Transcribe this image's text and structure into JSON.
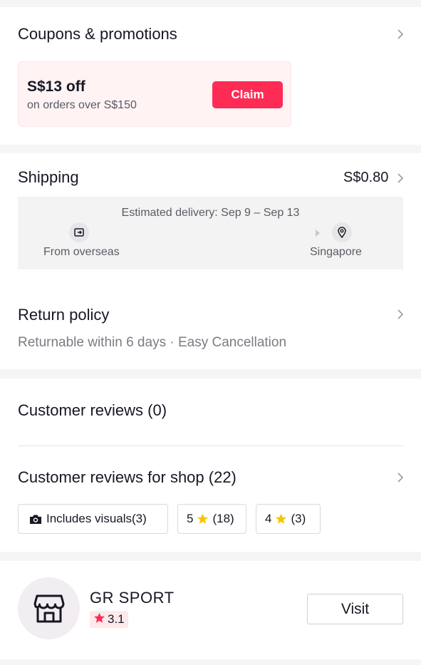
{
  "coupons": {
    "section_title": "Coupons & promotions",
    "coupon_title": "S$13 off",
    "coupon_subtitle": "on orders over S$150",
    "claim_label": "Claim"
  },
  "shipping": {
    "section_title": "Shipping",
    "price": "S$0.80",
    "estimate": "Estimated delivery: Sep 9 – Sep 13",
    "from_label": "From overseas",
    "to_label": "Singapore"
  },
  "return_policy": {
    "section_title": "Return policy",
    "subtitle": "Returnable within 6 days · Easy Cancellation"
  },
  "reviews": {
    "product_title": "Customer reviews (0)",
    "shop_title": "Customer reviews for shop (22)",
    "chips": [
      {
        "label": "Includes visuals(3)"
      },
      {
        "stars": "5",
        "count": "(18)"
      },
      {
        "stars": "4",
        "count": "(3)"
      }
    ]
  },
  "shop": {
    "name": "GR SPORT",
    "rating": "3.1",
    "visit_label": "Visit"
  },
  "colors": {
    "accent": "#fe2c55",
    "star": "#f7c600",
    "rating_star": "#fe2c55"
  },
  "icons": [
    "chevron-right-icon",
    "package-icon",
    "location-pin-icon",
    "camera-icon",
    "star-icon",
    "store-icon"
  ]
}
